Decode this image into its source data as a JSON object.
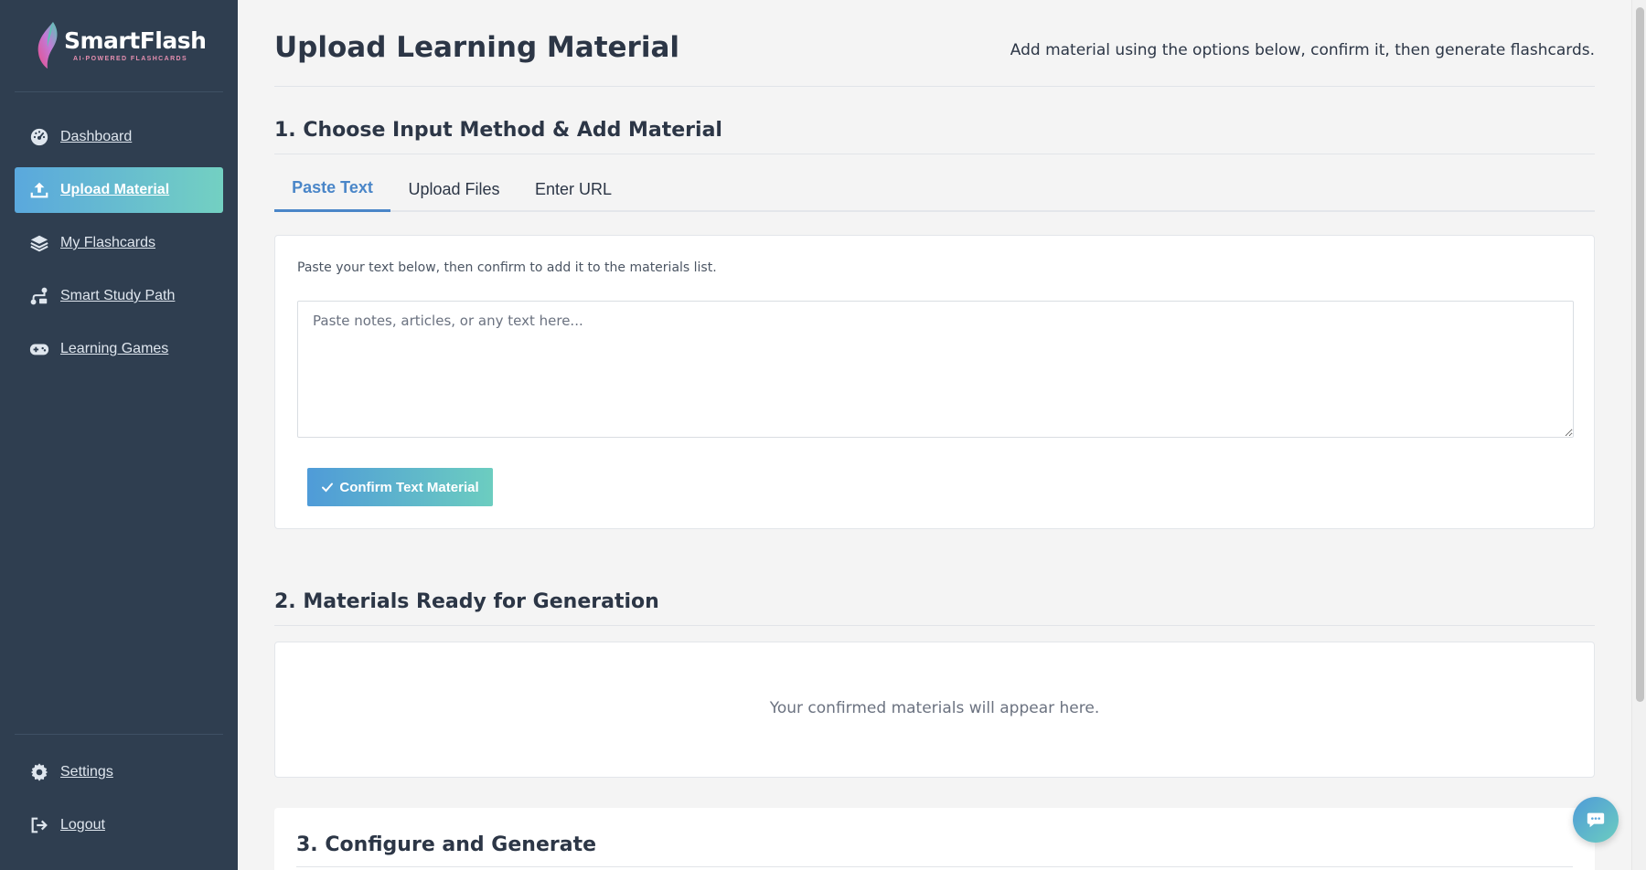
{
  "brand": {
    "name": "SmartFlash",
    "tagline": "AI-POWERED FLASHCARDS",
    "gradient_start": "#5aa8dd",
    "gradient_end": "#73d0c2",
    "logo_colors": [
      "#e64e8c",
      "#b67ce0",
      "#58c7b3"
    ]
  },
  "sidebar": {
    "background": "#2f3e50",
    "items": [
      {
        "label": "Dashboard",
        "icon": "dashboard-gauge-icon",
        "active": false
      },
      {
        "label": "Upload Material",
        "icon": "upload-icon",
        "active": true
      },
      {
        "label": "My Flashcards",
        "icon": "layers-icon",
        "active": false
      },
      {
        "label": "Smart Study Path",
        "icon": "route-icon",
        "active": false
      },
      {
        "label": "Learning Games",
        "icon": "gamepad-icon",
        "active": false
      }
    ],
    "footer_items": [
      {
        "label": "Settings",
        "icon": "gear-icon"
      },
      {
        "label": "Logout",
        "icon": "logout-icon"
      }
    ]
  },
  "header": {
    "title": "Upload Learning Material",
    "subtitle": "Add material using the options below, confirm it, then generate flashcards."
  },
  "section1": {
    "title": "1. Choose Input Method & Add Material",
    "tabs": [
      {
        "label": "Paste Text",
        "active": true
      },
      {
        "label": "Upload Files",
        "active": false
      },
      {
        "label": "Enter URL",
        "active": false
      }
    ],
    "help_text": "Paste your text below, then confirm to add it to the materials list.",
    "textarea": {
      "value": "",
      "placeholder": "Paste notes, articles, or any text here..."
    },
    "confirm_label": "Confirm Text Material",
    "accent": "#4a86c8"
  },
  "section2": {
    "title": "2. Materials Ready for Generation",
    "empty_text": "Your confirmed materials will appear here."
  },
  "section3": {
    "title": "3. Configure and Generate"
  },
  "chat": {
    "icon": "chat-bubble-icon"
  }
}
